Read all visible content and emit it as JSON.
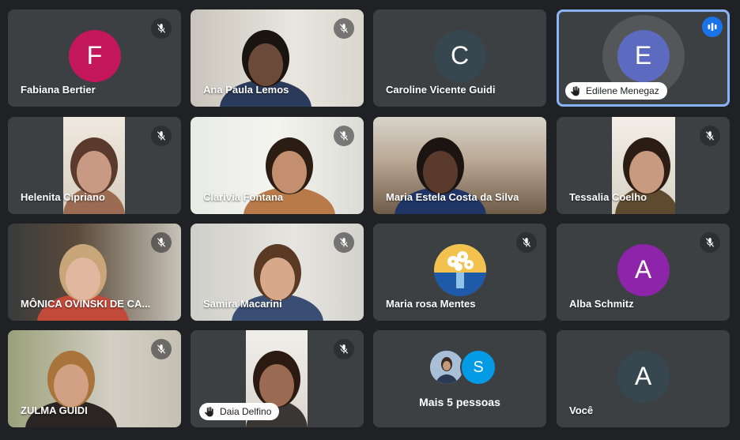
{
  "tiles": [
    {
      "name": "Fabiana Bertier",
      "type": "avatar",
      "initial": "F",
      "color": "#c2185b",
      "muted": true
    },
    {
      "name": "Ana Paula Lemos",
      "type": "video",
      "muted": true
    },
    {
      "name": "Caroline Vicente Guidi",
      "type": "avatar",
      "initial": "C",
      "color": "#37474f",
      "muted": false
    },
    {
      "name": "Edilene Menegaz",
      "type": "avatar",
      "initial": "E",
      "color": "#5c6bc0",
      "muted": false,
      "speaking": true,
      "hand_raised": true
    },
    {
      "name": "Helenita Cipriano",
      "type": "video",
      "muted": true
    },
    {
      "name": "Clarivia Fontana",
      "type": "video",
      "muted": true
    },
    {
      "name": "Maria Estela Costa da Silva",
      "type": "video",
      "muted": false
    },
    {
      "name": "Tessalia Coelho",
      "type": "video",
      "muted": true
    },
    {
      "name": "MÔNICA OVINSKI DE CA...",
      "type": "video",
      "muted": true
    },
    {
      "name": "Samira Macarini",
      "type": "video",
      "muted": true
    },
    {
      "name": "Maria rosa Mentes",
      "type": "photo",
      "muted": true
    },
    {
      "name": "Alba Schmitz",
      "type": "avatar",
      "initial": "A",
      "color": "#8e24aa",
      "muted": true
    },
    {
      "name": "ZULMA GUIDI",
      "type": "video",
      "muted": true
    },
    {
      "name": "Daia Delfino",
      "type": "video",
      "muted": true,
      "hand_raised": true
    },
    {
      "name": "Mais 5 pessoas",
      "type": "more",
      "extra_initial": "S",
      "extra_color": "#039be5",
      "muted": false
    },
    {
      "name": "Você",
      "type": "avatar",
      "initial": "A",
      "color": "#37474f",
      "muted": false
    }
  ]
}
